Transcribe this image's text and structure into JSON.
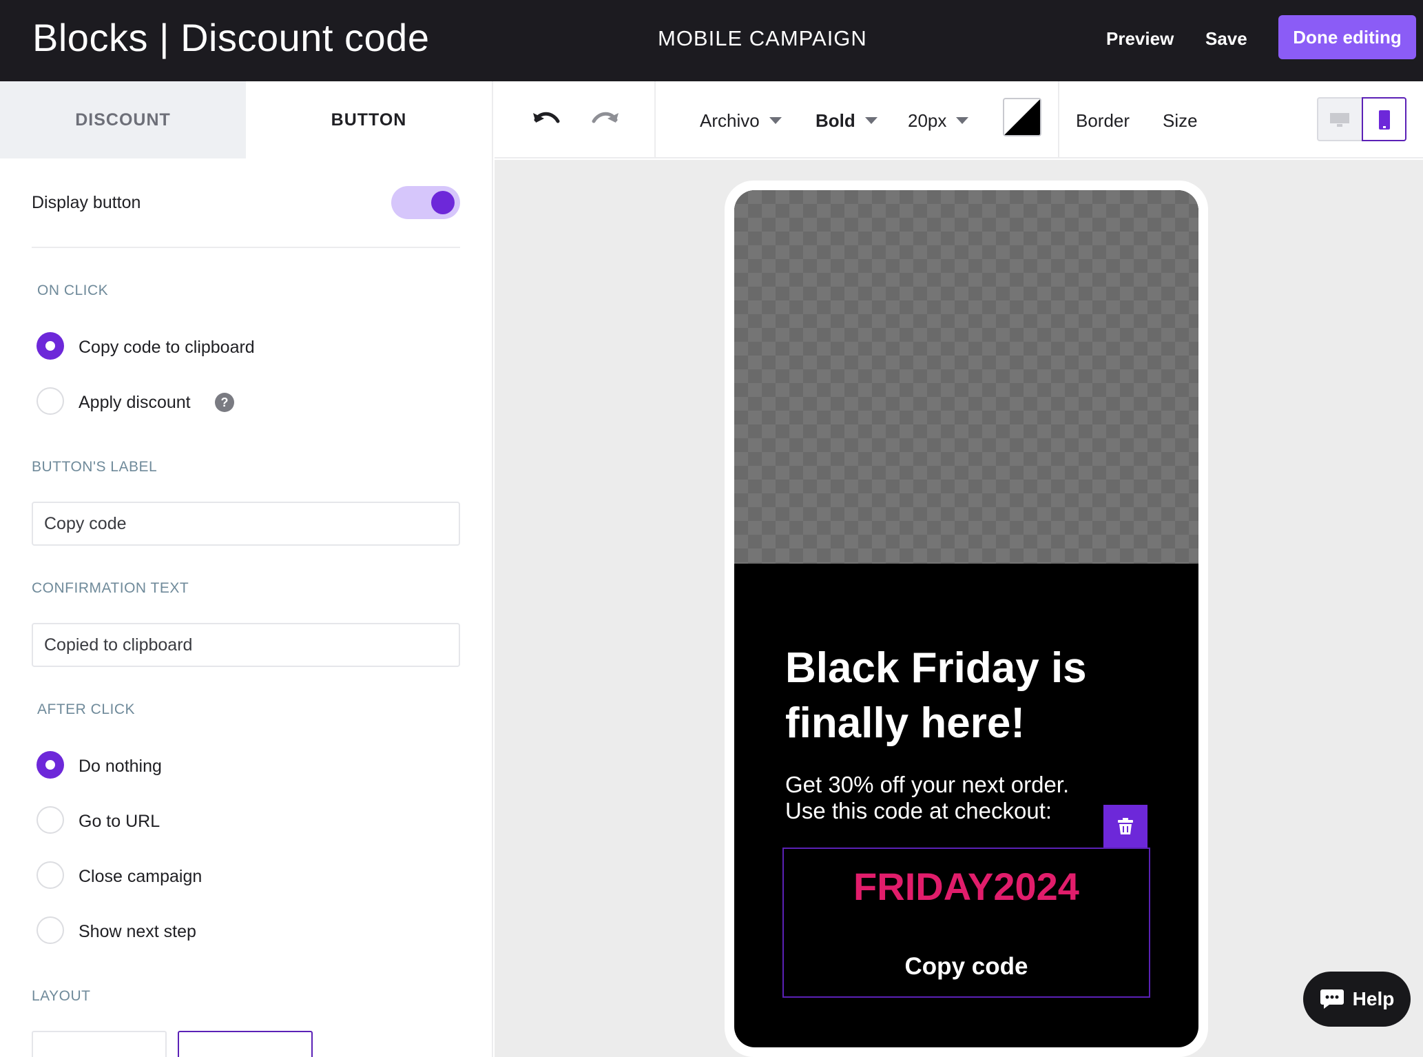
{
  "header": {
    "title": "Blocks | Discount code",
    "campaign": "MOBILE CAMPAIGN",
    "preview_label": "Preview",
    "save_label": "Save",
    "done_label": "Done editing",
    "accent_color": "#8b5cf6"
  },
  "tabs": [
    {
      "label": "DISCOUNT",
      "active": false
    },
    {
      "label": "BUTTON",
      "active": true
    }
  ],
  "settings": {
    "display_button_label": "Display button",
    "display_button_on": true,
    "on_click": {
      "heading": "ON CLICK",
      "options": [
        {
          "label": "Copy code to clipboard",
          "selected": true
        },
        {
          "label": "Apply discount",
          "selected": false,
          "help": "?"
        }
      ]
    },
    "button_label": {
      "heading": "BUTTON'S LABEL",
      "value": "Copy code"
    },
    "confirmation_text": {
      "heading": "CONFIRMATION TEXT",
      "value": "Copied to clipboard"
    },
    "after_click": {
      "heading": "AFTER CLICK",
      "options": [
        {
          "label": "Do nothing",
          "selected": true
        },
        {
          "label": "Go to URL",
          "selected": false
        },
        {
          "label": "Close campaign",
          "selected": false
        },
        {
          "label": "Show next step",
          "selected": false
        }
      ]
    },
    "layout": {
      "heading": "LAYOUT",
      "selected_index": 1
    }
  },
  "toolbar": {
    "font_family": "Archivo",
    "font_weight": "Bold",
    "font_size": "20px",
    "border_label": "Border",
    "size_label": "Size",
    "device": "mobile"
  },
  "preview": {
    "headline": "Black Friday is finally here!",
    "body_line1": "Get 30% off your next order.",
    "body_line2": "Use this code at checkout:",
    "code": "FRIDAY2024",
    "button_text": "Copy code",
    "code_color": "#e11d6b"
  },
  "help_chip": {
    "label": "Help"
  }
}
